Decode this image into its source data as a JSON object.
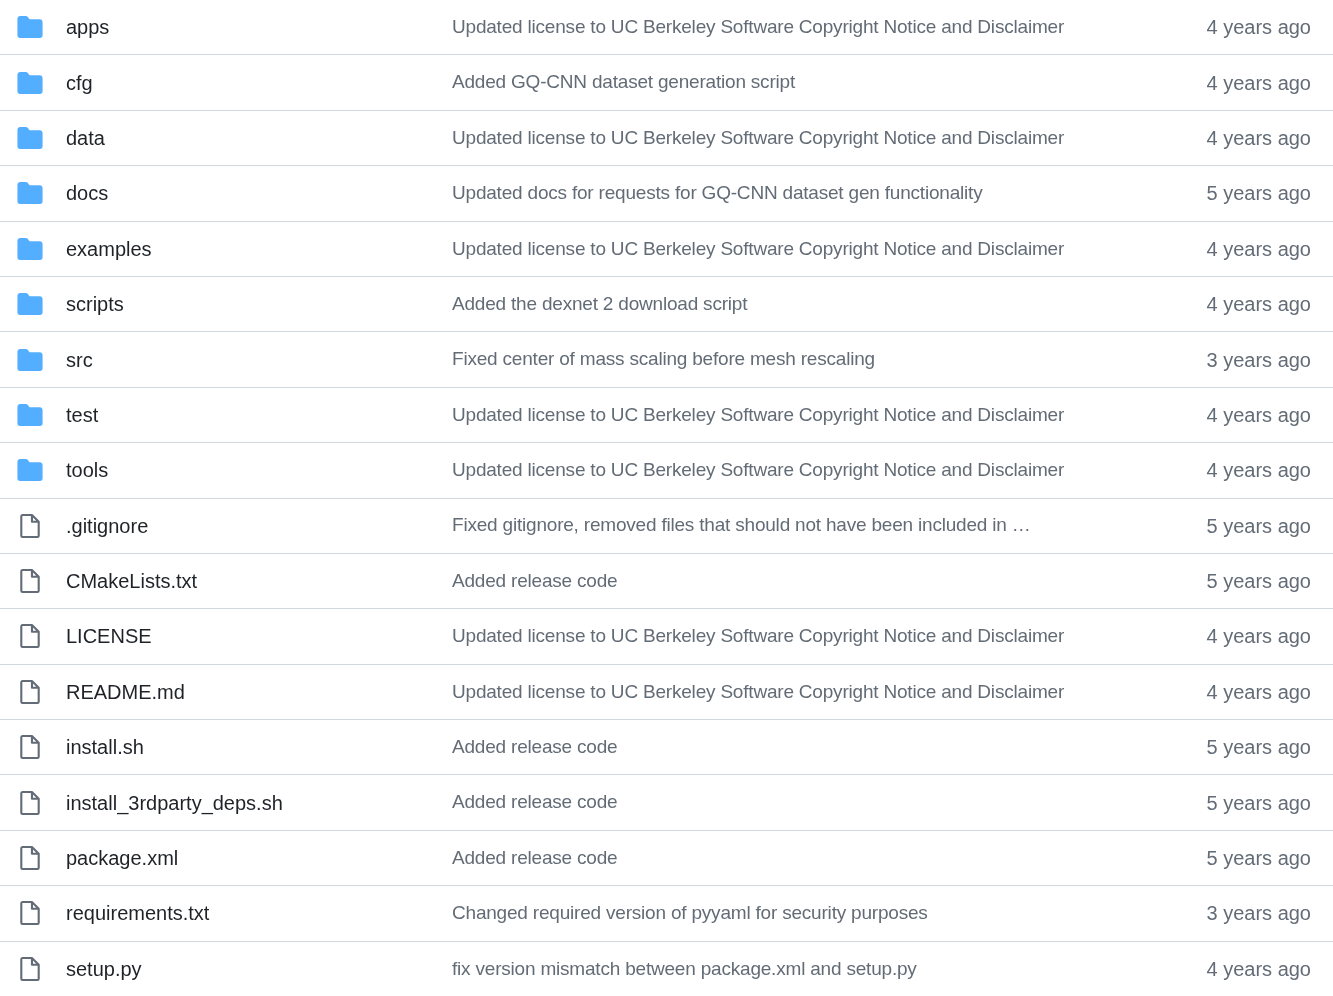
{
  "rows": [
    {
      "kind": "folder",
      "name": "apps",
      "message": "Updated license to UC Berkeley Software Copyright Notice and Disclaimer",
      "time": "4 years ago"
    },
    {
      "kind": "folder",
      "name": "cfg",
      "message": "Added GQ-CNN dataset generation script",
      "time": "4 years ago"
    },
    {
      "kind": "folder",
      "name": "data",
      "message": "Updated license to UC Berkeley Software Copyright Notice and Disclaimer",
      "time": "4 years ago"
    },
    {
      "kind": "folder",
      "name": "docs",
      "message": "Updated docs for requests for GQ-CNN dataset gen functionality",
      "time": "5 years ago"
    },
    {
      "kind": "folder",
      "name": "examples",
      "message": "Updated license to UC Berkeley Software Copyright Notice and Disclaimer",
      "time": "4 years ago"
    },
    {
      "kind": "folder",
      "name": "scripts",
      "message": "Added the dexnet 2 download script",
      "time": "4 years ago"
    },
    {
      "kind": "folder",
      "name": "src",
      "message": "Fixed center of mass scaling before mesh rescaling",
      "time": "3 years ago"
    },
    {
      "kind": "folder",
      "name": "test",
      "message": "Updated license to UC Berkeley Software Copyright Notice and Disclaimer",
      "time": "4 years ago"
    },
    {
      "kind": "folder",
      "name": "tools",
      "message": "Updated license to UC Berkeley Software Copyright Notice and Disclaimer",
      "time": "4 years ago"
    },
    {
      "kind": "file",
      "name": ".gitignore",
      "message": "Fixed gitignore, removed files that should not have been included in …",
      "time": "5 years ago"
    },
    {
      "kind": "file",
      "name": "CMakeLists.txt",
      "message": "Added release code",
      "time": "5 years ago"
    },
    {
      "kind": "file",
      "name": "LICENSE",
      "message": "Updated license to UC Berkeley Software Copyright Notice and Disclaimer",
      "time": "4 years ago"
    },
    {
      "kind": "file",
      "name": "README.md",
      "message": "Updated license to UC Berkeley Software Copyright Notice and Disclaimer",
      "time": "4 years ago"
    },
    {
      "kind": "file",
      "name": "install.sh",
      "message": "Added release code",
      "time": "5 years ago"
    },
    {
      "kind": "file",
      "name": "install_3rdparty_deps.sh",
      "message": "Added release code",
      "time": "5 years ago"
    },
    {
      "kind": "file",
      "name": "package.xml",
      "message": "Added release code",
      "time": "5 years ago"
    },
    {
      "kind": "file",
      "name": "requirements.txt",
      "message": "Changed required version of pyyaml for security purposes",
      "time": "3 years ago"
    },
    {
      "kind": "file",
      "name": "setup.py",
      "message": "fix version mismatch between package.xml and setup.py",
      "time": "4 years ago"
    }
  ]
}
